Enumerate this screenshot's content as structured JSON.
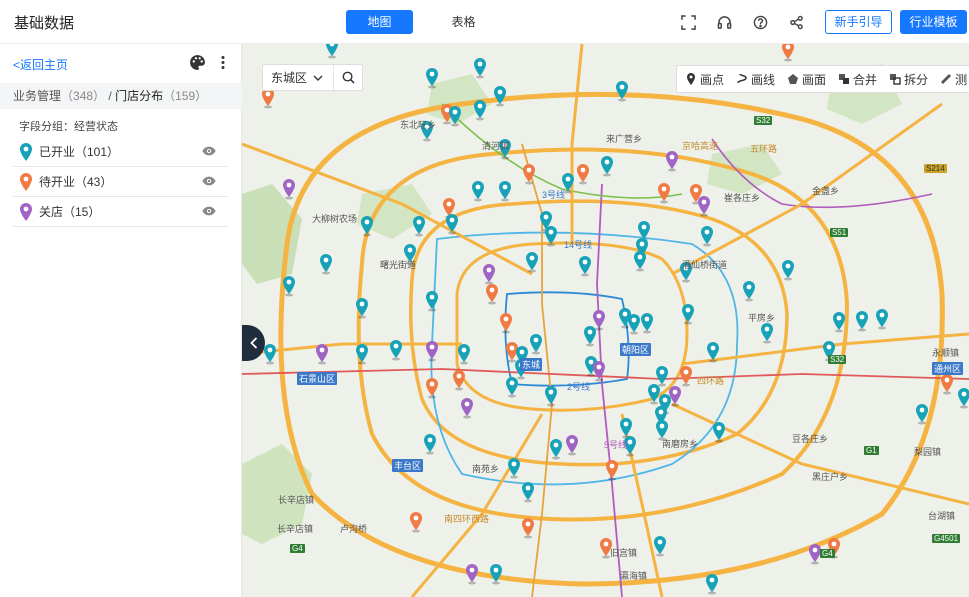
{
  "header": {
    "app_title": "基础数据",
    "tabs": [
      {
        "label": "地图",
        "active": true
      },
      {
        "label": "表格",
        "active": false
      }
    ],
    "icons": [
      "fullscreen-icon",
      "headset-icon",
      "help-icon",
      "share-icon"
    ],
    "guide_label": "新手引导",
    "template_label": "行业模板",
    "accent": "#1677ff"
  },
  "sidebar": {
    "back_label": "<返回主页",
    "breadcrumb": {
      "root": "业务管理",
      "root_count": "（348）",
      "sep": "/",
      "current": "门店分布",
      "current_count": "（159）"
    },
    "group_label": "字段分组：经营状态",
    "statuses": [
      {
        "label": "已开业（101）",
        "color": "#17a2b8"
      },
      {
        "label": "待开业（43）",
        "color": "#f07a43"
      },
      {
        "label": "关店（15）",
        "color": "#a064c4"
      }
    ]
  },
  "map": {
    "district": "东城区",
    "tools": [
      "画点",
      "画线",
      "画面",
      "合并",
      "拆分",
      "测"
    ],
    "labels": [
      "东北旺乡",
      "清河镇",
      "来广营乡",
      "崔各庄乡",
      "金盏乡",
      "大柳树农场",
      "酒仙桥街道",
      "曙光街道",
      "平房乡",
      "朝阳区",
      "永顺镇",
      "石景山区",
      "通州区",
      "豆各庄乡",
      "丰台区",
      "梨园镇",
      "长辛店镇",
      "黑庄户乡",
      "长辛店镇",
      "卢沟桥",
      "南苑乡",
      "旧宫镇",
      "台湖镇",
      "瀛海镇",
      "南磨房乡",
      "东城",
      "3号线",
      "14号线",
      "5号线",
      "2号线",
      "四环路",
      "五环路",
      "南四环西路",
      "京哈高速"
    ],
    "shields": [
      "S32",
      "S214",
      "S51",
      "S32",
      "G1",
      "G4501",
      "G4",
      "G4"
    ]
  }
}
